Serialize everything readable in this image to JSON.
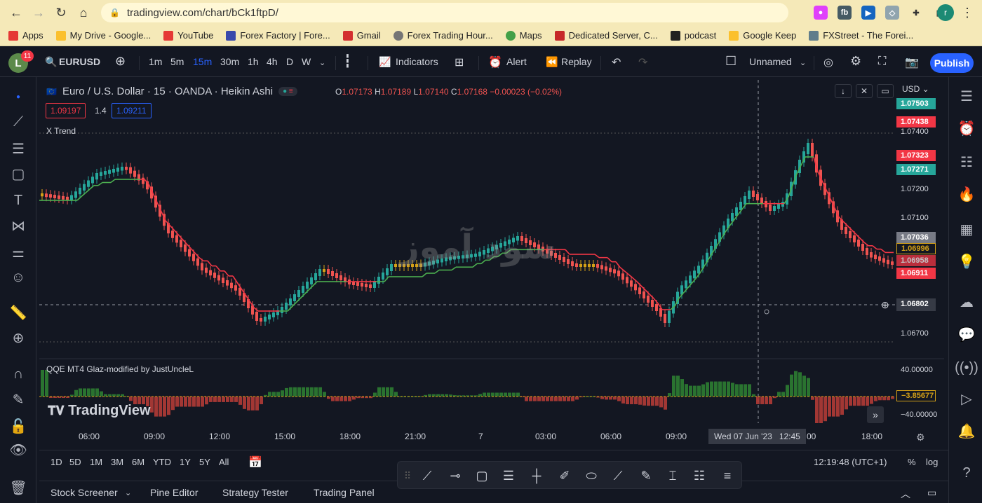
{
  "browser": {
    "url": "tradingview.com/chart/bCk1ftpD/",
    "profile_initial": "r",
    "bookmarks": [
      "Apps",
      "My Drive - Google...",
      "YouTube",
      "Forex Factory | Fore...",
      "Gmail",
      "Forex Trading Hour...",
      "Maps",
      "Dedicated Server, C...",
      "podcast",
      "Google Keep",
      "FXStreet - The Forei..."
    ]
  },
  "toolbar": {
    "avatar": "L",
    "badge": "11",
    "symbol": "EURUSD",
    "intervals": [
      "1m",
      "5m",
      "15m",
      "30m",
      "1h",
      "4h",
      "D",
      "W"
    ],
    "active_interval": "15m",
    "indicators": "Indicators",
    "alert": "Alert",
    "replay": "Replay",
    "layout_name": "Unnamed",
    "publish": "Publish"
  },
  "legend": {
    "title": "Euro / U.S. Dollar · 15 · OANDA · Heikin Ashi",
    "o_label": "O",
    "o": "1.07173",
    "h_label": "H",
    "h": "1.07189",
    "l_label": "L",
    "l": "1.07140",
    "c_label": "C",
    "c": "1.07168",
    "change": "−0.00023 (−0.02%)",
    "sell": "1.09197",
    "spread": "1.4",
    "buy": "1.09211",
    "xtrend": "X Trend",
    "indicator": "QQE MT4 Glaz-modified by JustUncleL",
    "currency": "USD"
  },
  "price_labels": [
    {
      "text": "1.07503",
      "color": "#26a69a"
    },
    {
      "text": "1.07438",
      "color": "#f23645"
    },
    {
      "text": "1.07323",
      "color": "#f23645"
    },
    {
      "text": "1.07271",
      "color": "#26a69a"
    },
    {
      "text": "1.07036",
      "color": "#787b86"
    },
    {
      "text": "1.06996",
      "color": "#131722"
    },
    {
      "text": "1.06958",
      "color": "#f23645"
    },
    {
      "text": "1.06911",
      "color": "#f23645"
    }
  ],
  "price_ticks": [
    "1.07400",
    "1.07200",
    "1.07100",
    "1.06700"
  ],
  "crosshair": {
    "price": "1.06802",
    "date": "Wed 07 Jun '23",
    "time": "12:45"
  },
  "indicator_ticks": [
    "40.00000",
    "−3.85677",
    "−40.00000"
  ],
  "time_ticks": [
    "06:00",
    "09:00",
    "12:00",
    "15:00",
    "18:00",
    "21:00",
    "7",
    "03:00",
    "06:00",
    "09:00",
    "00",
    "18:00"
  ],
  "bottom": {
    "ranges": [
      "1D",
      "5D",
      "1M",
      "3M",
      "6M",
      "YTD",
      "1Y",
      "5Y",
      "All"
    ],
    "clock": "12:19:48 (UTC+1)",
    "percent": "%",
    "log": "log"
  },
  "panels": [
    "Stock Screener",
    "Pine Editor",
    "Strategy Tester",
    "Trading Panel"
  ],
  "watermark": "TradingView",
  "watermark_fa": "سود آموز",
  "chart_data": {
    "type": "candlestick",
    "title": "Euro / U.S. Dollar · 15 · OANDA · Heikin Ashi",
    "ylim": [
      1.0665,
      1.0755
    ],
    "series": [
      {
        "name": "X Trend",
        "values": []
      }
    ],
    "candle_colors": {
      "up": "#26a69a",
      "down": "#ef5350",
      "neutral": "#d4a017"
    },
    "trend_colors": {
      "up": "#4caf50",
      "down": "#f23645"
    }
  }
}
